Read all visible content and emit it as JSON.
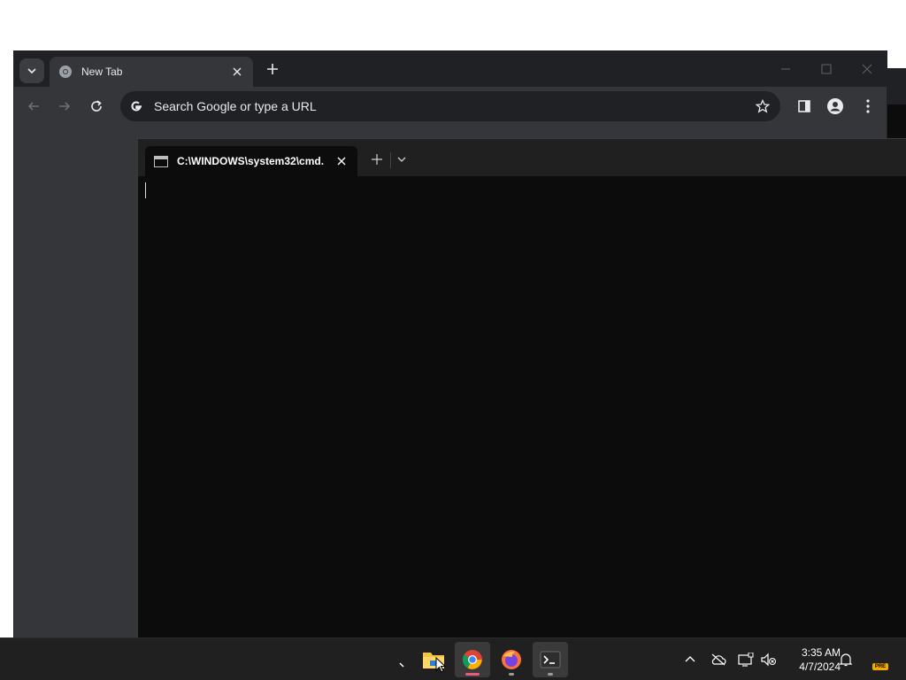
{
  "browser": {
    "tab_title": "New Tab",
    "omnibox_placeholder": "Search Google or type a URL"
  },
  "terminal": {
    "tab_title": "C:\\WINDOWS\\system32\\cmd."
  },
  "taskbar": {
    "time": "3:35 AM",
    "date": "4/7/2024",
    "badge": "PRE",
    "apps": [
      "File Explorer",
      "Google Chrome",
      "Firefox",
      "Terminal"
    ]
  },
  "colors": {
    "chrome_frame": "#202124",
    "chrome_toolbar": "#35363a",
    "terminal_bg": "#0c0c0c",
    "taskbar_bg": "#202020",
    "accent_pink": "#e95d7a"
  }
}
